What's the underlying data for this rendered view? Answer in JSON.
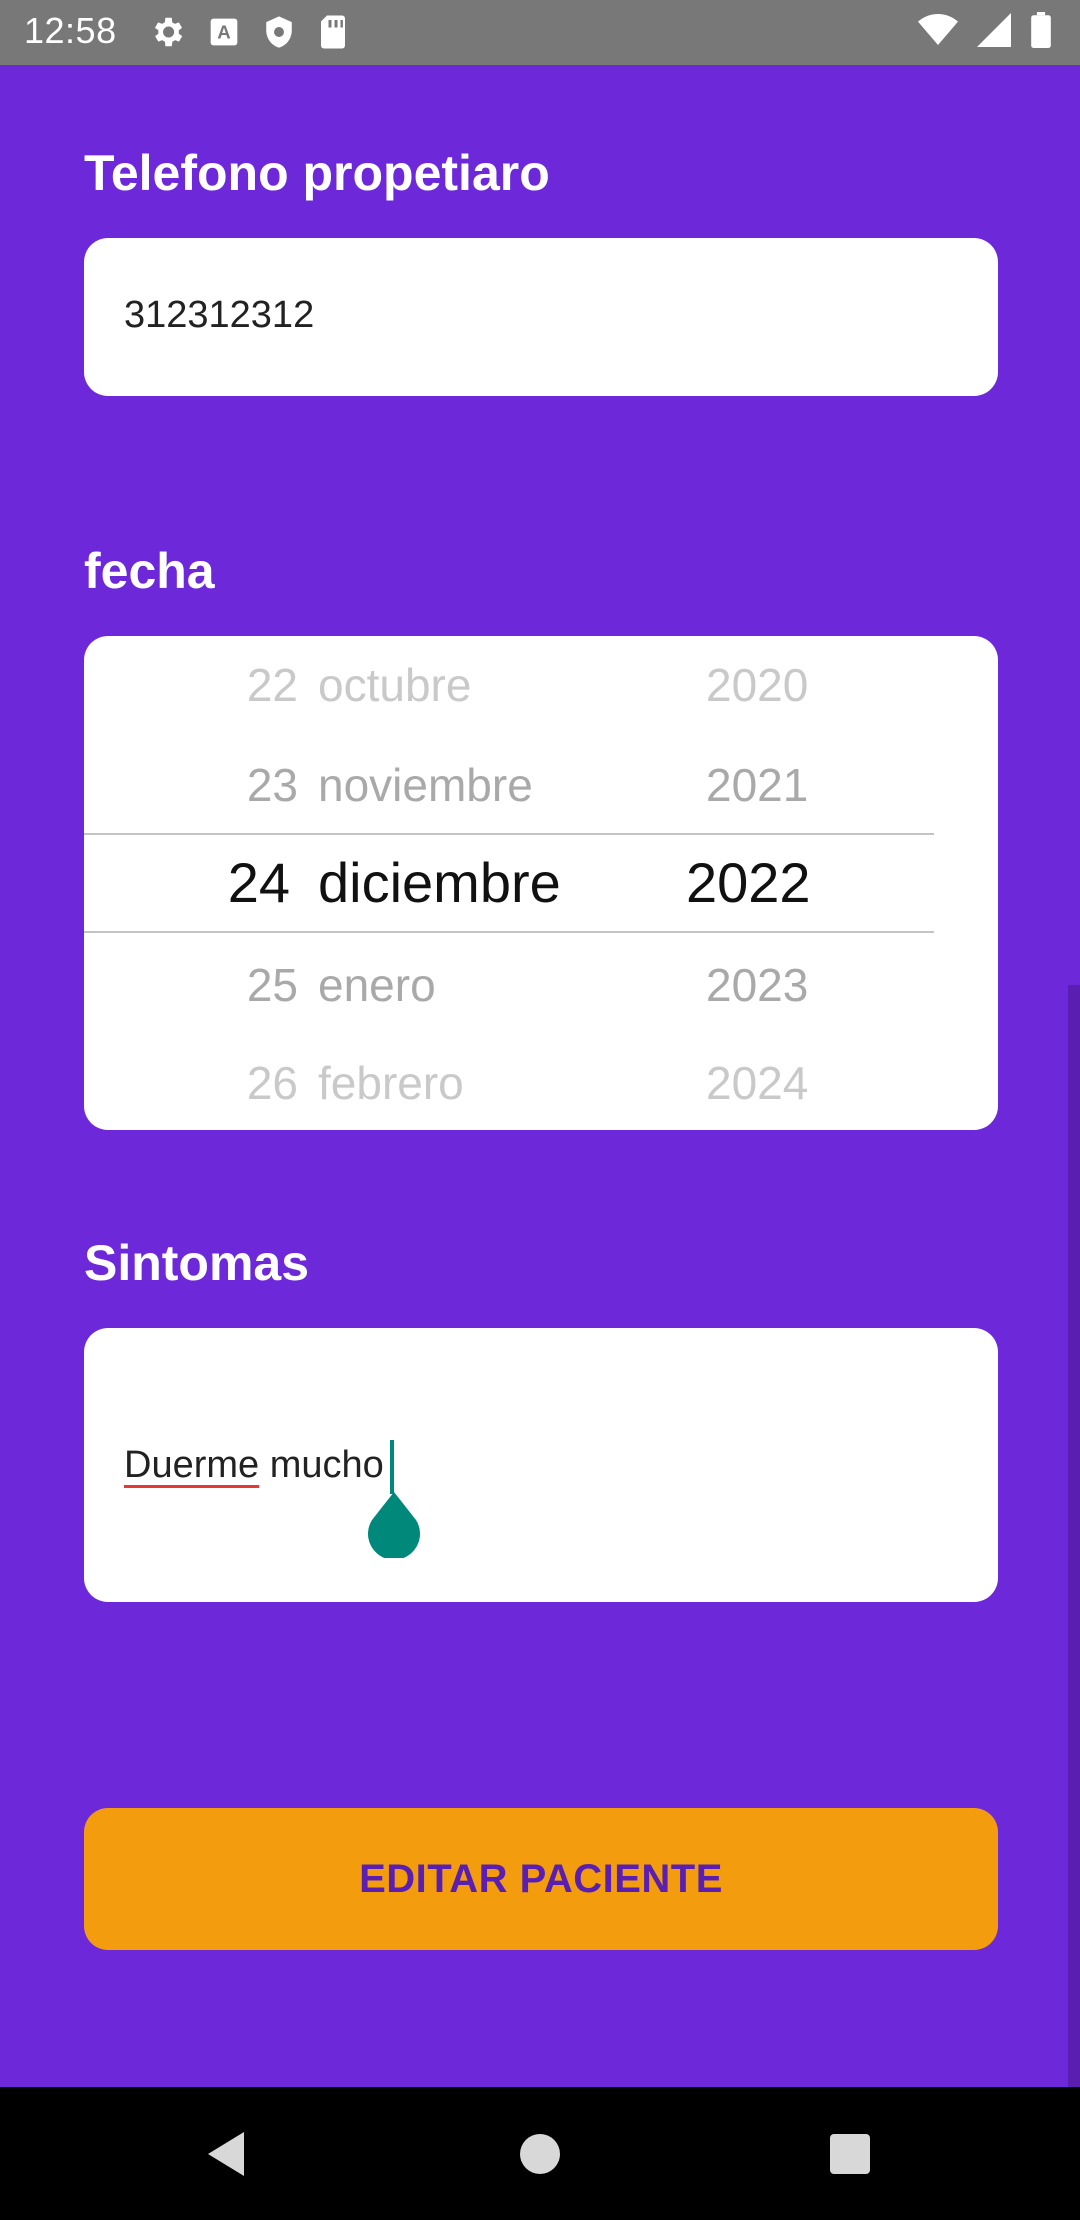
{
  "status_bar": {
    "time": "12:58",
    "left_icons": [
      "settings-icon",
      "a-notification-icon",
      "shield-icon",
      "sd-card-icon"
    ],
    "right_icons": [
      "wifi-icon",
      "signal-icon",
      "battery-icon"
    ]
  },
  "owner_phone": {
    "label": "Telefono propetiaro",
    "value": "312312312"
  },
  "date": {
    "label": "fecha",
    "days": [
      "22",
      "23",
      "24",
      "25",
      "26"
    ],
    "months": [
      "octubre",
      "noviembre",
      "diciembre",
      "enero",
      "febrero"
    ],
    "years": [
      "2020",
      "2021",
      "2022",
      "2023",
      "2024"
    ],
    "selected": {
      "day": "24",
      "month": "diciembre",
      "year": "2022"
    }
  },
  "symptoms": {
    "label": "Sintomas",
    "value_word1": "Duerme",
    "value_word2": " mucho"
  },
  "submit_button": {
    "label": "EDITAR PACIENTE"
  },
  "colors": {
    "background": "#6c28d9",
    "button": "#f39c0d",
    "button_text": "#5a1fb0",
    "cursor": "#00897b",
    "spellcheck_underline": "#e53935"
  },
  "nav_bar": {
    "icons": [
      "back-icon",
      "home-icon",
      "recents-icon"
    ]
  }
}
